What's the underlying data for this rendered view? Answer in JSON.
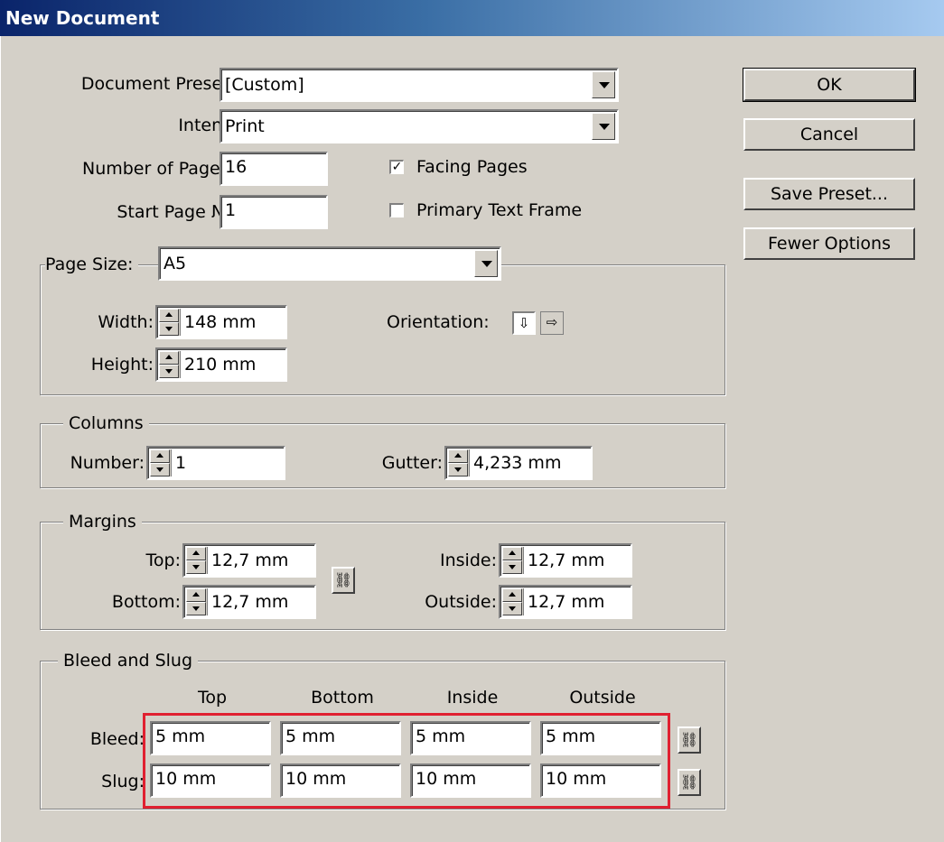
{
  "window": {
    "title": "New Document"
  },
  "general": {
    "document_preset_label": "Document Preset:",
    "document_preset_value": "[Custom]",
    "intent_label": "Intent:",
    "intent_value": "Print",
    "num_pages_label": "Number of Pages:",
    "num_pages_value": "16",
    "start_page_label": "Start Page №:",
    "start_page_value": "1",
    "facing_pages_label": "Facing Pages",
    "facing_pages_checked": true,
    "primary_text_frame_label": "Primary Text Frame",
    "primary_text_frame_checked": false
  },
  "buttons": {
    "ok": "OK",
    "cancel": "Cancel",
    "save_preset": "Save Preset...",
    "fewer_options": "Fewer Options"
  },
  "page_size": {
    "label": "Page Size:",
    "value": "A5",
    "width_label": "Width:",
    "width_value": "148 mm",
    "height_label": "Height:",
    "height_value": "210 mm",
    "orientation_label": "Orientation:",
    "orientation_selected": "portrait"
  },
  "columns": {
    "label": "Columns",
    "number_label": "Number:",
    "number_value": "1",
    "gutter_label": "Gutter:",
    "gutter_value": "4,233 mm"
  },
  "margins": {
    "label": "Margins",
    "top_label": "Top:",
    "top_value": "12,7 mm",
    "bottom_label": "Bottom:",
    "bottom_value": "12,7 mm",
    "inside_label": "Inside:",
    "inside_value": "12,7 mm",
    "outside_label": "Outside:",
    "outside_value": "12,7 mm"
  },
  "bleed_slug": {
    "label": "Bleed and Slug",
    "headers": [
      "Top",
      "Bottom",
      "Inside",
      "Outside"
    ],
    "bleed_label": "Bleed:",
    "bleed_values": [
      "5 mm",
      "5 mm",
      "5 mm",
      "5 mm"
    ],
    "slug_label": "Slug:",
    "slug_values": [
      "10 mm",
      "10 mm",
      "10 mm",
      "10 mm"
    ]
  },
  "colors": {
    "highlight": "#e02030",
    "titlebar_start": "#0a246a",
    "titlebar_end": "#a6caf0"
  },
  "icons": {
    "link": "chain-link-icon",
    "portrait": "portrait-page-icon",
    "landscape": "landscape-page-icon"
  }
}
